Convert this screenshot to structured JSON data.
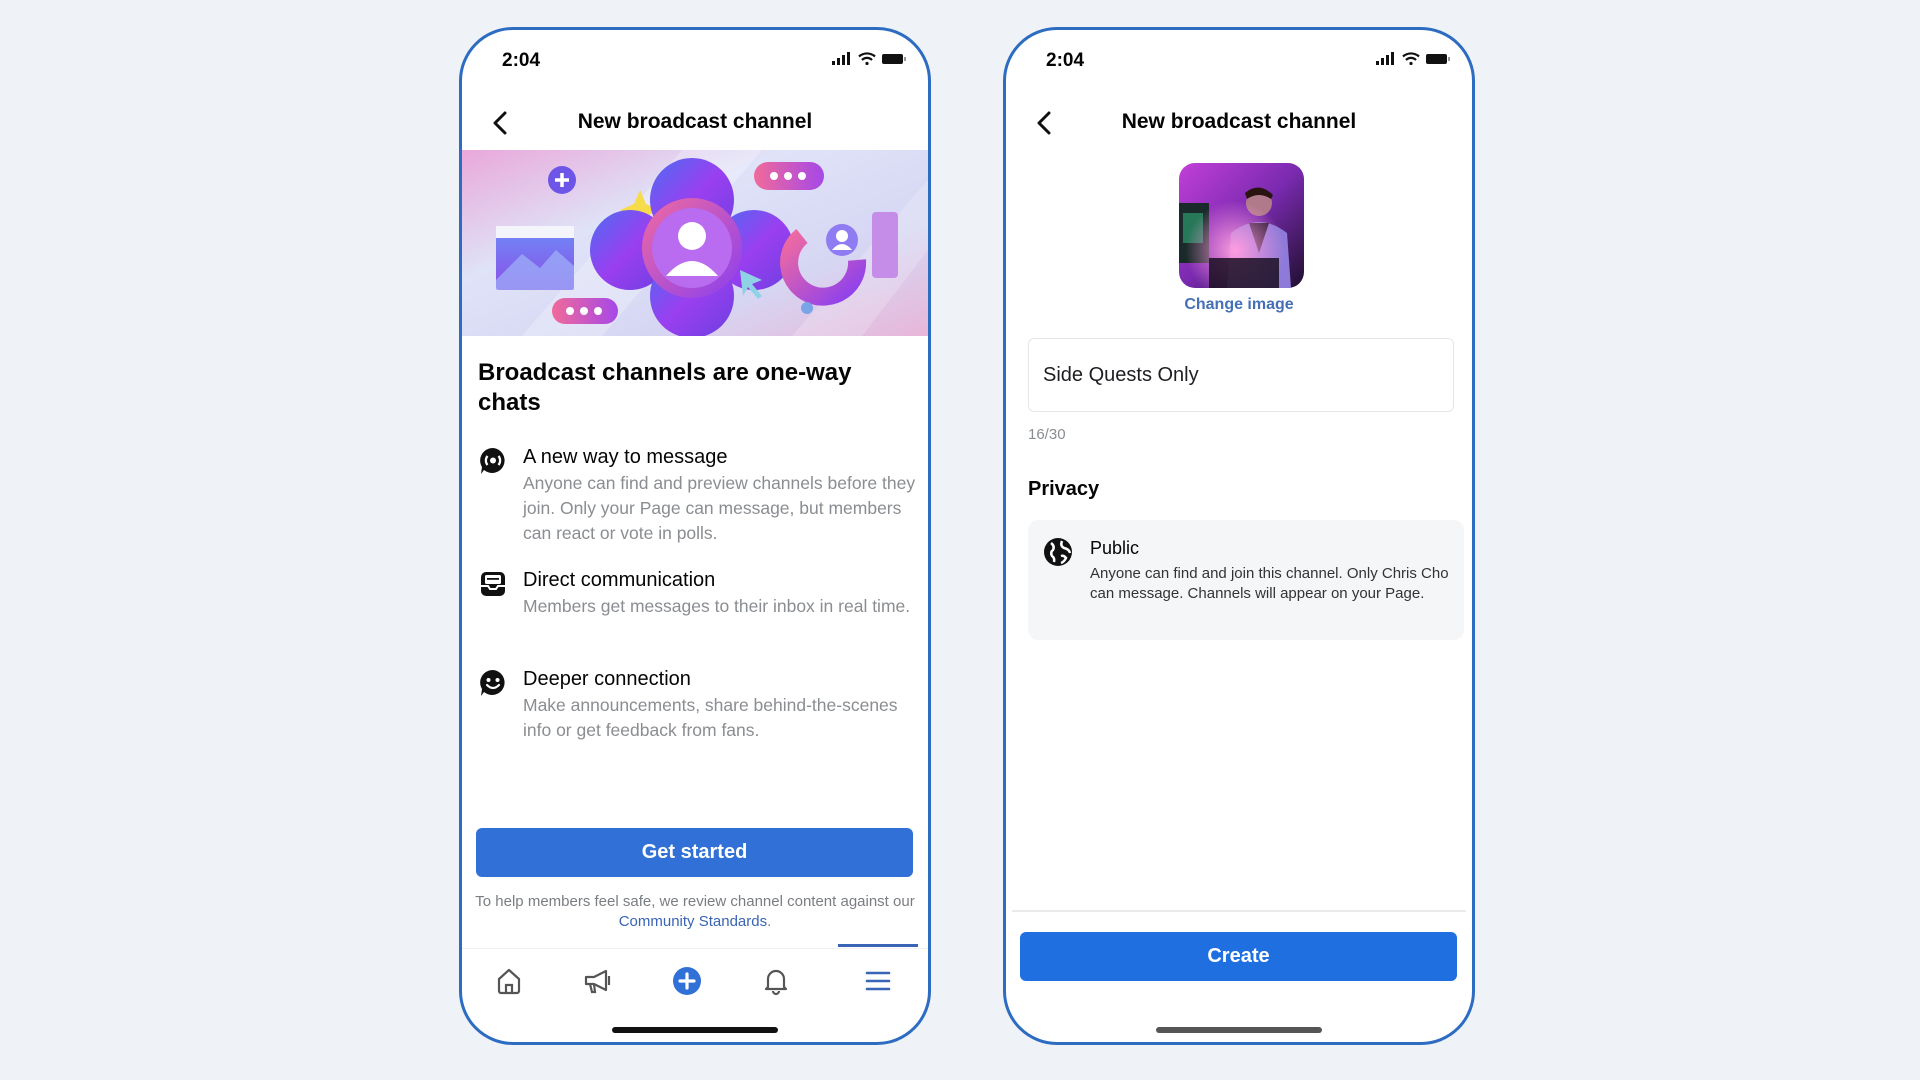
{
  "colors": {
    "background": "#eff3f7",
    "phone_border": "#2d6cc0",
    "primary_button": "#2d6cd8",
    "link": "#3a64b5",
    "secondary_text": "#8a8d91"
  },
  "left_screen": {
    "status": {
      "time": "2:04",
      "icons": [
        "signal-icon",
        "wifi-icon",
        "battery-icon"
      ]
    },
    "header": {
      "title": "New broadcast channel",
      "back_icon": "chevron-left-icon"
    },
    "banner": {
      "illustration": "broadcast-channel-illustration"
    },
    "heading": "Broadcast channels are one-way chats",
    "features": [
      {
        "icon": "message-broadcast-icon",
        "title": "A new way to message",
        "description": "Anyone can find and preview channels before they join. Only your Page can message, but members can react or vote in polls."
      },
      {
        "icon": "inbox-icon",
        "title": "Direct communication",
        "description": "Members get messages to their inbox in real time."
      },
      {
        "icon": "smile-bubble-icon",
        "title": "Deeper connection",
        "description": "Make announcements, share behind-the-scenes info or get feedback from fans."
      }
    ],
    "primary_button": "Get started",
    "footnote": {
      "text": "To help members feel safe, we review channel content against our ",
      "link": "Community Standards",
      "suffix": "."
    },
    "nav": [
      {
        "name": "home",
        "icon": "home-icon"
      },
      {
        "name": "announcements",
        "icon": "megaphone-icon"
      },
      {
        "name": "create",
        "icon": "plus-circle-icon"
      },
      {
        "name": "notifications",
        "icon": "bell-icon"
      },
      {
        "name": "menu",
        "icon": "menu-icon",
        "active": true
      }
    ]
  },
  "right_screen": {
    "status": {
      "time": "2:04",
      "icons": [
        "signal-icon",
        "wifi-icon",
        "battery-icon"
      ]
    },
    "header": {
      "title": "New broadcast channel",
      "back_icon": "chevron-left-icon"
    },
    "avatar": {
      "description": "channel-image-gamer-photo"
    },
    "change_image": "Change image",
    "name_input": {
      "value": "Side Quests Only"
    },
    "counter": "16/30",
    "privacy": {
      "label": "Privacy",
      "option": {
        "icon": "globe-icon",
        "title": "Public",
        "description": "Anyone can find and join this channel. Only Chris Cho can message. Channels will appear on your Page."
      }
    },
    "primary_button": "Create"
  }
}
